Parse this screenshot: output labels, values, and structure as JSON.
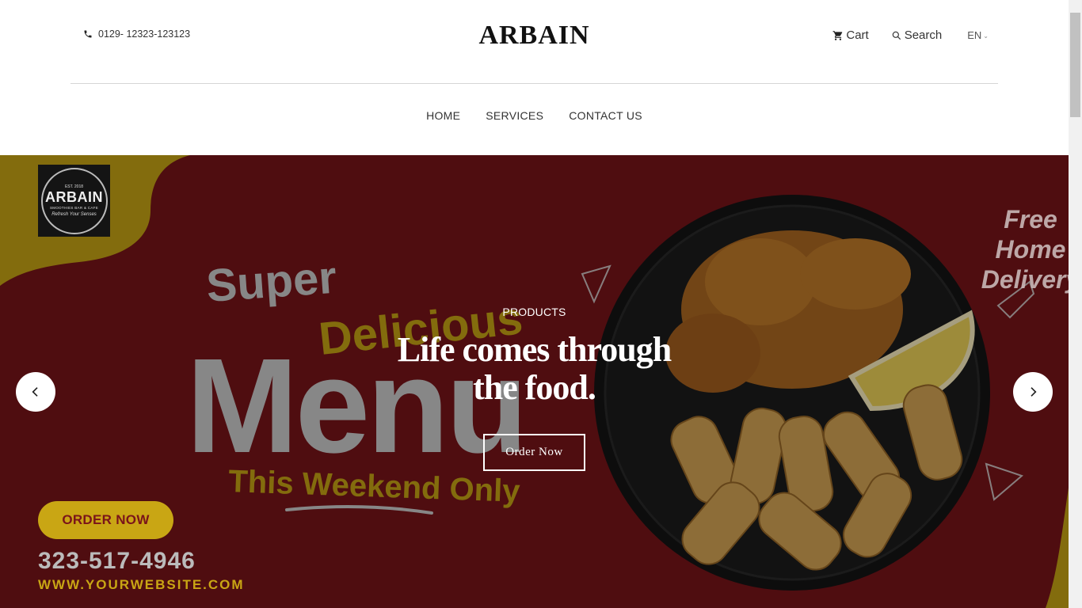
{
  "header": {
    "phone": "0129- 12323-123123",
    "brand": "ARBAIN",
    "cart_label": "Cart",
    "search_label": "Search",
    "language": "EN"
  },
  "nav": {
    "items": [
      "HOME",
      "SERVICES",
      "CONTACT US"
    ]
  },
  "hero": {
    "kicker": "PRODUCTS",
    "title": "Life comes through the food.",
    "cta_label": "Order Now",
    "banner": {
      "logo_top": "EST. 2018",
      "logo_name": "ARBAIN",
      "logo_tagline": "SMOOTHIES BAR & CAFE",
      "logo_signature": "Refresh Your Senses",
      "word_super": "Super",
      "word_delicious": "Delicious",
      "word_menu": "Menu",
      "word_weekend": "This Weekend Only",
      "promo_button": "ORDER NOW",
      "promo_phone": "323-517-4946",
      "promo_website": "WWW.YOURWEBSITE.COM",
      "delivery_line1": "Free Home",
      "delivery_line2": "Delivery"
    }
  },
  "colors": {
    "banner_red": "#7a141a",
    "banner_gold": "#c9a614",
    "plate": "#1c1c1c"
  },
  "icons": {
    "phone": "phone-icon",
    "cart": "cart-icon",
    "search": "search-icon",
    "prev": "chevron-left-icon",
    "next": "chevron-right-icon"
  }
}
